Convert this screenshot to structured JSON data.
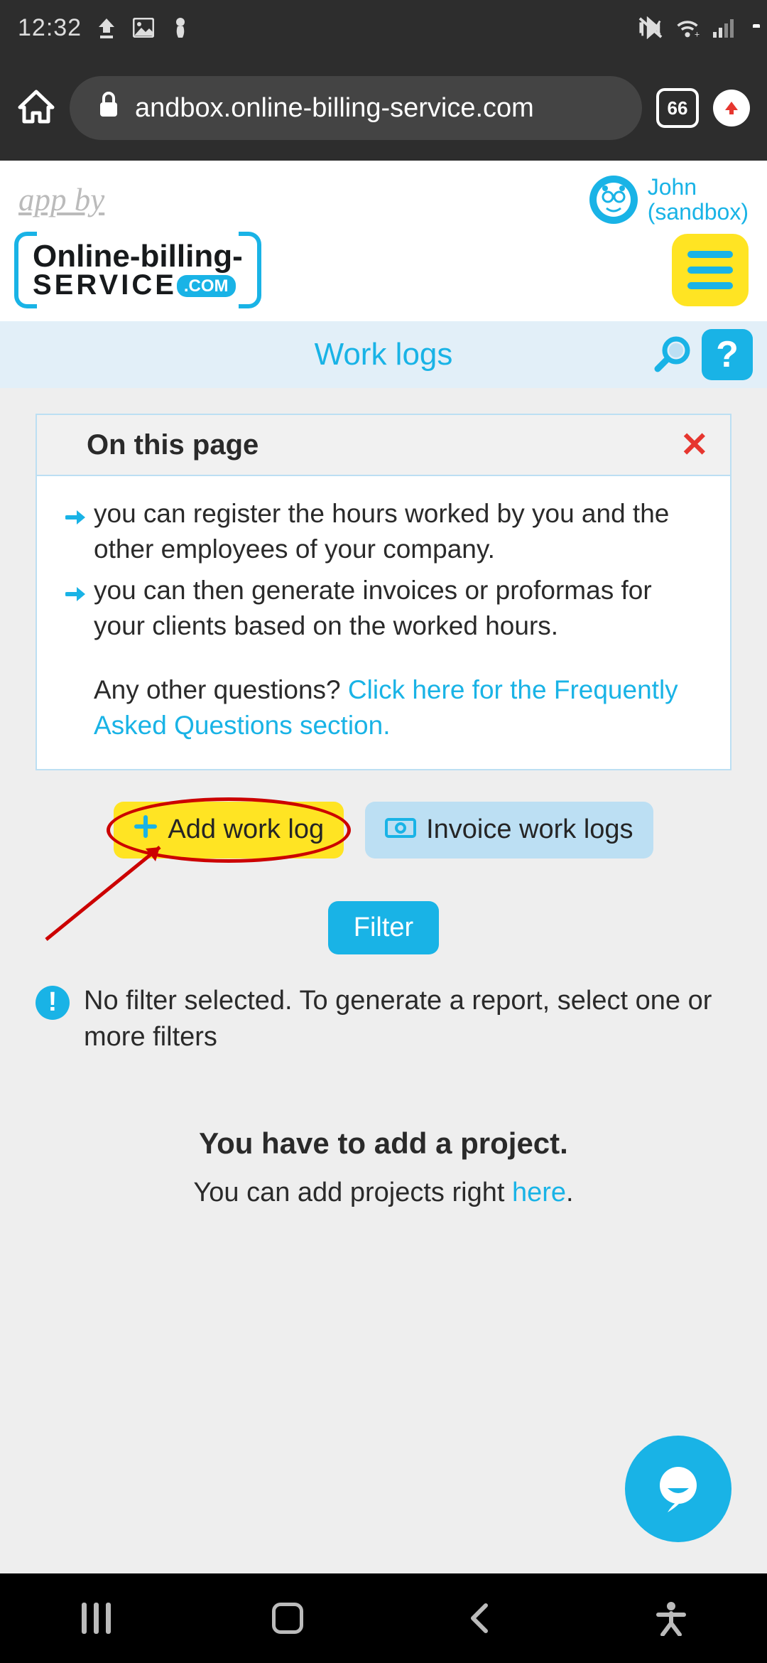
{
  "status": {
    "time": "12:32"
  },
  "browser": {
    "url": "andbox.online-billing-service.com",
    "tab_count": "66"
  },
  "header": {
    "app_by": "app by",
    "logo_line1": "Online-billing-",
    "logo_line2": "SERVICE",
    "logo_suffix": ".com",
    "user_name": "John",
    "user_env": "(sandbox)"
  },
  "title_bar": {
    "title": "Work logs",
    "help": "?"
  },
  "info": {
    "head": "On this page",
    "bullets": [
      "you can register the hours worked by you and the other employees of your company.",
      "you can then generate invoices or proformas for your clients based on the worked hours."
    ],
    "faq_prefix": "Any other questions? ",
    "faq_link": "Click here for the Frequently Asked Questions section."
  },
  "buttons": {
    "add": "Add work log",
    "invoice": "Invoice work logs",
    "filter": "Filter"
  },
  "alert": "No filter selected. To generate a report, select one or more filters",
  "project": {
    "heading": "You have to add a project.",
    "sub_prefix": "You can add projects right ",
    "sub_link": "here",
    "sub_suffix": "."
  },
  "colors": {
    "accent": "#19b3e6",
    "yellow": "#ffe423",
    "red": "#cc0000"
  }
}
